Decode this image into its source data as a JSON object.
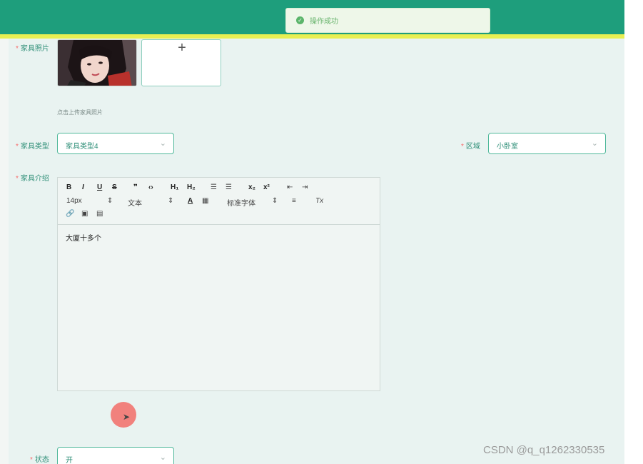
{
  "toast": {
    "message": "操作成功",
    "icon": "success-check-icon"
  },
  "form": {
    "photo_label": "家具照片",
    "photo_hint": "点击上传家具照片",
    "upload_symbol": "+",
    "type_label": "家具类型",
    "type_value": "家具类型4",
    "area_label": "区域",
    "area_value": "小卧室",
    "intro_label": "家具介绍",
    "status_label": "状态",
    "status_value": "开",
    "required_mark": "*",
    "select_arrow": "⌄"
  },
  "editor": {
    "toolbar": {
      "bold": "B",
      "italic": "I",
      "underline": "U",
      "strike": "S",
      "blockquote": "❞",
      "code": "‹›",
      "h1": "H₁",
      "h2": "H₂",
      "ordered_list": "☰",
      "bullet_list": "☰",
      "subscript": "x₂",
      "superscript": "x²",
      "indent_decrease": "⇤",
      "indent_increase": "⇥",
      "font_size": "14px",
      "text_type": "文本",
      "font_color": "A",
      "bg_color": "▦",
      "font_family": "标准字体",
      "align": "≡",
      "clear_format": "Tx",
      "link": "🔗",
      "image": "▣",
      "video": "▤",
      "dropdown_caret": "⇕"
    },
    "content": "大厦十多个"
  },
  "watermark": "CSDN @q_q1262330535",
  "colors": {
    "topbar": "#1e9e7c",
    "stripe": "#e8ef52",
    "accent": "#2f8f78",
    "background": "#e9f3f1"
  }
}
